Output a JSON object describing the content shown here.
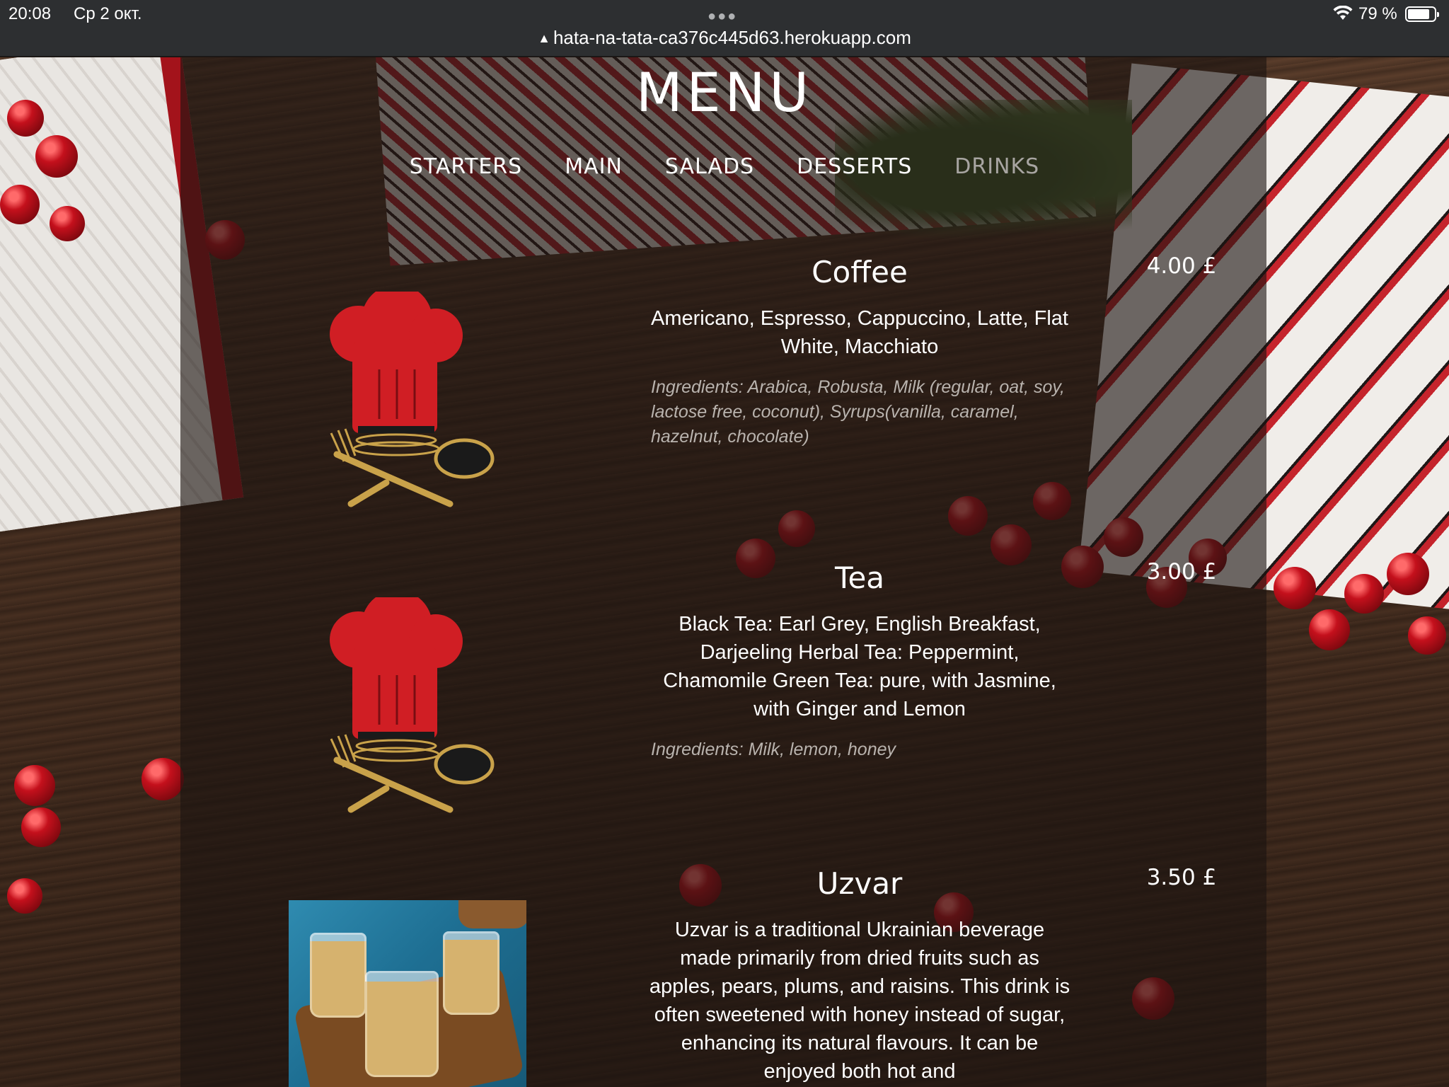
{
  "status_bar": {
    "time": "20:08",
    "date": "Ср 2 окт.",
    "url": "hata-na-tata-ca376c445d63.herokuapp.com",
    "battery": "79 %"
  },
  "page": {
    "title": "MENU",
    "nav": [
      {
        "label": "STARTERS",
        "active": false
      },
      {
        "label": "MAIN",
        "active": false
      },
      {
        "label": "SALADS",
        "active": false
      },
      {
        "label": "DESSERTS",
        "active": false
      },
      {
        "label": "DRINKS",
        "active": true
      }
    ]
  },
  "items": [
    {
      "name": "Coffee",
      "price": "4.00 £",
      "description": "Americano, Espresso, Cappuccino, Latte, Flat White, Macchiato",
      "ingredients": "Ingredients: Arabica, Robusta, Milk (regular, oat, soy, lactose free, coconut), Syrups(vanilla, caramel, hazelnut, chocolate)",
      "image": "chef-hat-icon"
    },
    {
      "name": "Tea",
      "price": "3.00 £",
      "description": "Black Tea: Earl Grey, English Breakfast, Darjeeling Herbal Tea: Peppermint, Chamomile Green Tea: pure, with Jasmine, with Ginger and Lemon",
      "ingredients": "Ingredients: Milk, lemon, honey",
      "image": "chef-hat-icon"
    },
    {
      "name": "Uzvar",
      "price": "3.50 £",
      "description": "Uzvar is a traditional Ukrainian beverage made primarily from dried fruits such as apples, pears, plums, and raisins. This drink is often sweetened with honey instead of sugar, enhancing its natural flavours. It can be enjoyed both hot and",
      "image": "uzvar-photo"
    }
  ],
  "colors": {
    "accent_red": "#d01e24",
    "gold": "#c9a24a",
    "nav_active": "#a8a5a2",
    "overlay": "#1c1410"
  }
}
